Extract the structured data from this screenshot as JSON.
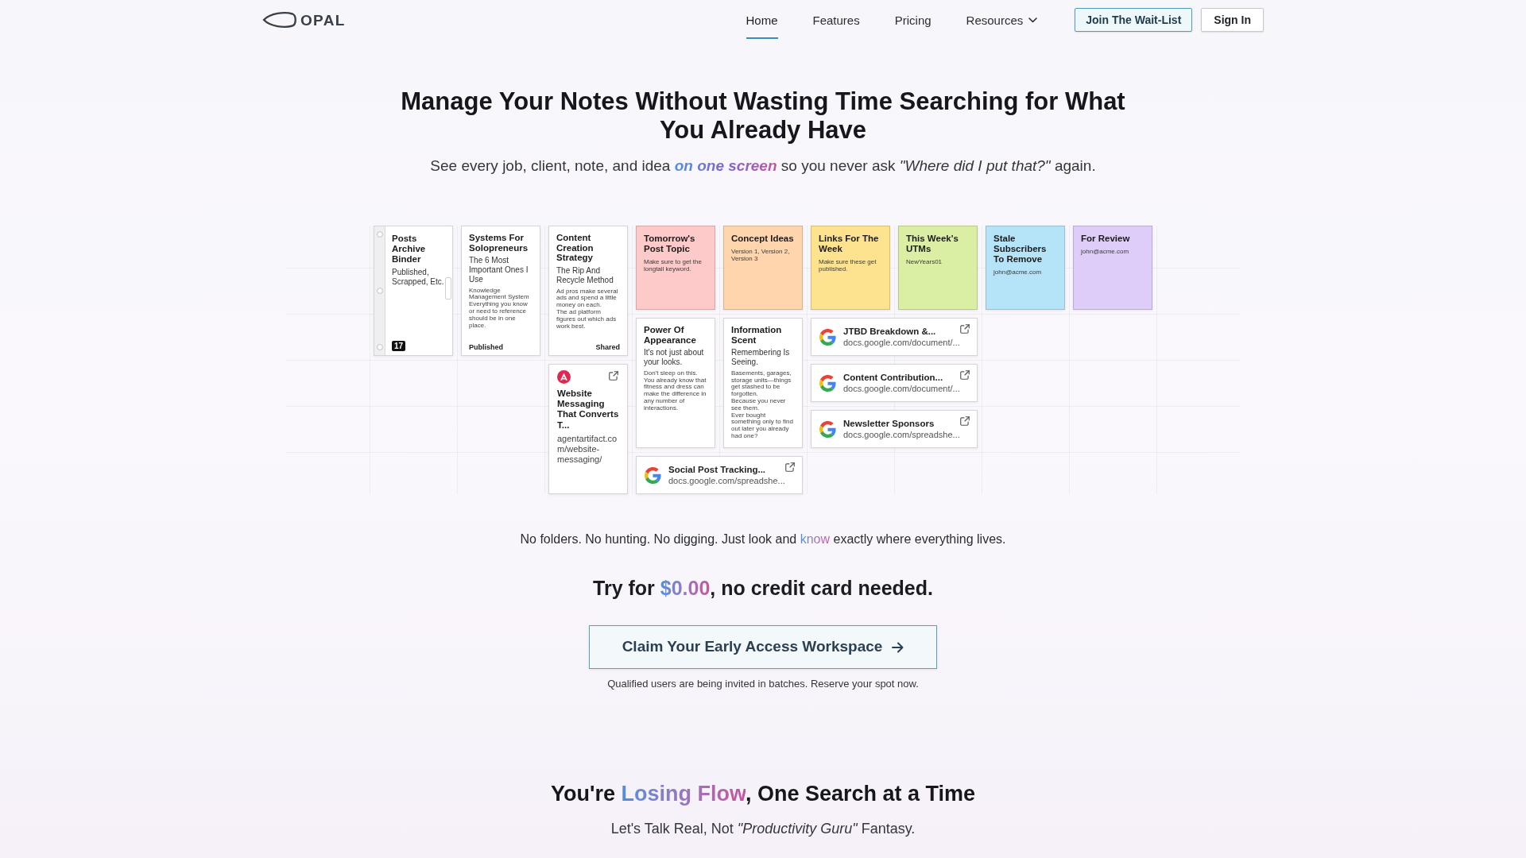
{
  "header": {
    "logo": {
      "text": "OPAL"
    },
    "nav": [
      {
        "label": "Home",
        "selected": true,
        "dropdown": false
      },
      {
        "label": "Features",
        "selected": false,
        "dropdown": false
      },
      {
        "label": "Pricing",
        "selected": false,
        "dropdown": false
      },
      {
        "label": "Resources",
        "selected": false,
        "dropdown": true
      }
    ],
    "buttons": [
      {
        "label": "Join The Wait-List",
        "kind": "primary"
      },
      {
        "label": "Sign In",
        "kind": "secondary"
      }
    ]
  },
  "hero": {
    "headline": "Manage Your Notes Without Wasting Time Searching for What You Already Have",
    "subtitle": [
      {
        "kind": "plain",
        "text": "See every job, client, note, and idea "
      },
      {
        "kind": "accent_em",
        "text": "on one screen"
      },
      {
        "kind": "plain",
        "text": " so you never ask "
      },
      {
        "kind": "quote",
        "text": "\"Where did I put that?\""
      },
      {
        "kind": "plain",
        "text": " again."
      }
    ]
  },
  "board": {
    "cards": [
      {
        "kind": "binder",
        "title": "Posts Archive Binder",
        "subtitle": "Published, Scrapped, Etc.",
        "badge": "17"
      },
      {
        "kind": "note",
        "title": "Systems For Solopreneurs",
        "subtitle": "The 6 Most Important Ones I Use",
        "body": [
          "Knowledge Management System",
          "Everything you know or need to reference should be in one place."
        ],
        "footer": "Published"
      },
      {
        "kind": "note",
        "title": "Content Creation Strategy",
        "subtitle": "The Rip And Recycle Method",
        "body": [
          "Ad pros make several ads and spend a little money on each.",
          "The ad platform figures out which ads work best."
        ],
        "footer": "Shared"
      },
      {
        "kind": "sticky",
        "title": "Tomorrow's Post Topic",
        "body": [
          "Make sure to get the longtail keyword."
        ],
        "color": "#fdc9c9"
      },
      {
        "kind": "sticky",
        "title": "Concept Ideas",
        "body": [
          "Version 1, Version 2, Version 3"
        ],
        "color": "#fed5ad"
      },
      {
        "kind": "sticky",
        "title": "Links For The Week",
        "body": [
          "Make sure these get published."
        ],
        "color": "#fde38f"
      },
      {
        "kind": "sticky",
        "title": "This Week's UTMs",
        "body": [
          "NewYears01"
        ],
        "color": "#daefa3"
      },
      {
        "kind": "sticky",
        "title": "Stale Subscribers To Remove",
        "body": [
          "john@acme.com"
        ],
        "color": "#b5e3f8"
      },
      {
        "kind": "sticky",
        "title": "For Review",
        "body": [
          "john@acme.com"
        ],
        "color": "#ddcdf8"
      },
      {
        "kind": "note",
        "title": "Power Of Appearance",
        "subtitle": "It's not just about your looks.",
        "body": [
          "Don't sleep on this.",
          "You already know that fitness and dress can make the difference in any number of interactions."
        ]
      },
      {
        "kind": "note",
        "title": "Information Scent",
        "subtitle": "Remembering Is Seeing.",
        "body": [
          "Basements, garages, storage units—things get stashed to be forgotten.",
          "Because you never see them.",
          "Ever bought something only to find out later you already had one?"
        ]
      },
      {
        "kind": "link",
        "title": "JTBD Breakdown &...",
        "url": "docs.google.com/document/..."
      },
      {
        "kind": "link_large",
        "title": "Website Messaging That Converts T...",
        "url": "agentartifact.com/website-messaging/"
      },
      {
        "kind": "link",
        "title": "Content Contribution...",
        "url": "docs.google.com/document/..."
      },
      {
        "kind": "link",
        "title": "Newsletter Sponsors",
        "url": "docs.google.com/spreadshe..."
      },
      {
        "kind": "link",
        "title": "Social Post Tracking...",
        "url": "docs.google.com/spreadshe..."
      }
    ]
  },
  "tagline": [
    {
      "kind": "plain",
      "text": "No folders. No hunting. No digging. Just look and "
    },
    {
      "kind": "accent",
      "text": "know"
    },
    {
      "kind": "plain",
      "text": " exactly where everything lives."
    }
  ],
  "offer": [
    {
      "kind": "plain",
      "text": "Try for "
    },
    {
      "kind": "accent",
      "text": "$0.00"
    },
    {
      "kind": "plain",
      "text": ", no credit card needed."
    }
  ],
  "cta": {
    "label": "Claim Your Early Access Workspace",
    "note": "Qualified users are being invited in batches. Reserve your spot now."
  },
  "section": {
    "heading": [
      {
        "kind": "plain",
        "text": "You're "
      },
      {
        "kind": "accent",
        "text": "Losing Flow"
      },
      {
        "kind": "plain",
        "text": ", One Search at a Time"
      }
    ],
    "subheading": "Let's Talk Real, Not *\"Productivity Guru\"* Fantasy."
  }
}
